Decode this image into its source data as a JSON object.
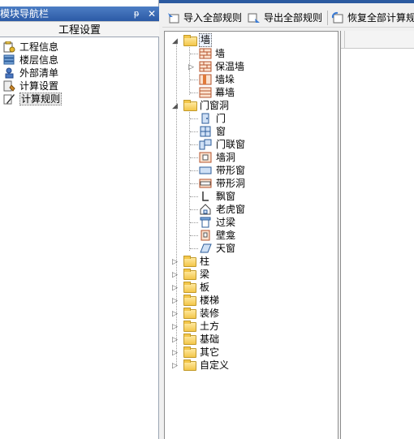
{
  "nav_panel": {
    "title": "模块导航栏",
    "pin_glyph": "ᵽ",
    "close_glyph": "✕",
    "section": "工程设置",
    "items": [
      {
        "label": "工程信息",
        "icon": "project-info-icon"
      },
      {
        "label": "楼层信息",
        "icon": "floor-info-icon"
      },
      {
        "label": "外部清单",
        "icon": "external-list-icon"
      },
      {
        "label": "计算设置",
        "icon": "calc-settings-icon"
      },
      {
        "label": "计算规则",
        "icon": "calc-rules-icon",
        "selected": true
      }
    ]
  },
  "toolbar": {
    "import_label": "导入全部规则",
    "export_label": "导出全部规则",
    "restore_label": "恢复全部计算规"
  },
  "tree": {
    "wall": {
      "label": "墙",
      "children": [
        "墙",
        "保温墙",
        "墙垛",
        "幕墙"
      ]
    },
    "openings": {
      "label": "门窗洞",
      "children": [
        "门",
        "窗",
        "门联窗",
        "墙洞",
        "带形窗",
        "带形洞",
        "飘窗",
        "老虎窗",
        "过梁",
        "壁龛",
        "天窗"
      ]
    },
    "collapsed": [
      "柱",
      "梁",
      "板",
      "楼梯",
      "装修",
      "土方",
      "基础",
      "其它",
      "自定义"
    ]
  },
  "colors": {
    "header_blue": "#2c5aa6",
    "folder_yellow": "#f3c64a"
  }
}
